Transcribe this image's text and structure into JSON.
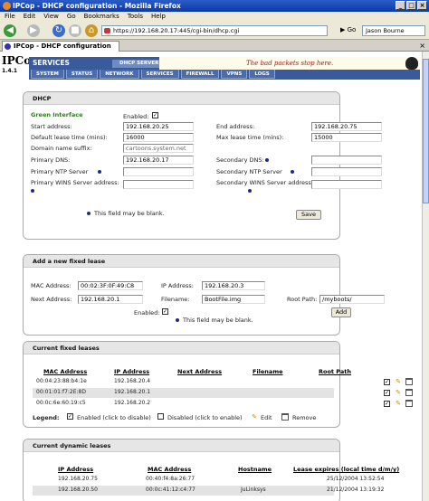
{
  "window": {
    "title": "IPCop - DHCP configuration - Mozilla Firefox"
  },
  "menu": [
    "File",
    "Edit",
    "View",
    "Go",
    "Bookmarks",
    "Tools",
    "Help"
  ],
  "toolbar": {
    "url": "https://192.168.20.17:445/cgi-bin/dhcp.cgi",
    "go_label": "Go",
    "search_value": "Jason Bourne"
  },
  "tab": {
    "label": "IPCop - DHCP configuration"
  },
  "header": {
    "logo": "IPCop",
    "version": "1.4.1",
    "section": "SERVICES",
    "subsection": "DHCP SERVER",
    "tagline": "The bad packets stop here.",
    "nav": [
      "SYSTEM",
      "STATUS",
      "NETWORK",
      "SERVICES",
      "FIREWALL",
      "VPNS",
      "LOGS"
    ]
  },
  "dhcp": {
    "title": "DHCP",
    "interface": "Green Interface",
    "enabled_label": "Enabled:",
    "start_label": "Start address:",
    "start_value": "192.168.20.25",
    "end_label": "End address:",
    "end_value": "192.168.20.75",
    "default_lease_label": "Default lease time (mins):",
    "default_lease_value": "16000",
    "max_lease_label": "Max lease time (mins):",
    "max_lease_value": "15000",
    "domain_label": "Domain name suffix:",
    "domain_value": "cartoons.system.net",
    "primary_dns_label": "Primary DNS:",
    "primary_dns_value": "192.168.20.17",
    "secondary_dns_label": "Secondary DNS:",
    "primary_ntp_label": "Primary NTP Server",
    "secondary_ntp_label": "Secondary NTP Server",
    "primary_wins_label": "Primary WINS Server address:",
    "secondary_wins_label": "Secondary WINS Server address:",
    "blank_note": "This field may be blank.",
    "save_label": "Save"
  },
  "fixed_add": {
    "title": "Add a new fixed lease",
    "mac_label": "MAC Address:",
    "mac_value": "00:02:3F:0F:49:C8",
    "ip_label": "IP Address:",
    "ip_value": "192.168.20.3",
    "next_label": "Next Address:",
    "next_value": "192.168.20.1",
    "filename_label": "Filename:",
    "filename_value": "BootFile.img",
    "root_label": "Root Path:",
    "root_value": "/myboots/",
    "enabled_label": "Enabled:",
    "blank_note": "This field may be blank.",
    "add_label": "Add"
  },
  "fixed_leases": {
    "title": "Current fixed leases",
    "headers": [
      "MAC Address",
      "IP Address",
      "Next Address",
      "Filename",
      "Root Path"
    ],
    "rows": [
      {
        "mac": "00:04:23:88:b4:1e",
        "ip": "192.168.20.4",
        "next": "",
        "file": "",
        "root": ""
      },
      {
        "mac": "00:01:01:f7:2E:8D",
        "ip": "192.168.20.1",
        "next": "",
        "file": "",
        "root": ""
      },
      {
        "mac": "00:0c:6e:60:19:c5",
        "ip": "192.168.20.2",
        "next": "",
        "file": "",
        "root": ""
      }
    ],
    "legend_label": "Legend:",
    "legend_enabled": "Enabled (click to disable)",
    "legend_disabled": "Disabled (click to enable)",
    "legend_edit": "Edit",
    "legend_remove": "Remove"
  },
  "dynamic_leases": {
    "title": "Current dynamic leases",
    "headers": [
      "IP Address",
      "MAC Address",
      "Hostname",
      "Lease expires (local time d/m/y)"
    ],
    "rows": [
      {
        "ip": "192.168.20.75",
        "mac": "00:40:f4:8a:26:77",
        "host": "",
        "expires": "25/12/2004 13:52:54"
      },
      {
        "ip": "192.168.20.50",
        "mac": "00:0c:41:12:c4:77",
        "host": "JuLinksys",
        "expires": "21/12/2004 13:19:32"
      }
    ]
  }
}
